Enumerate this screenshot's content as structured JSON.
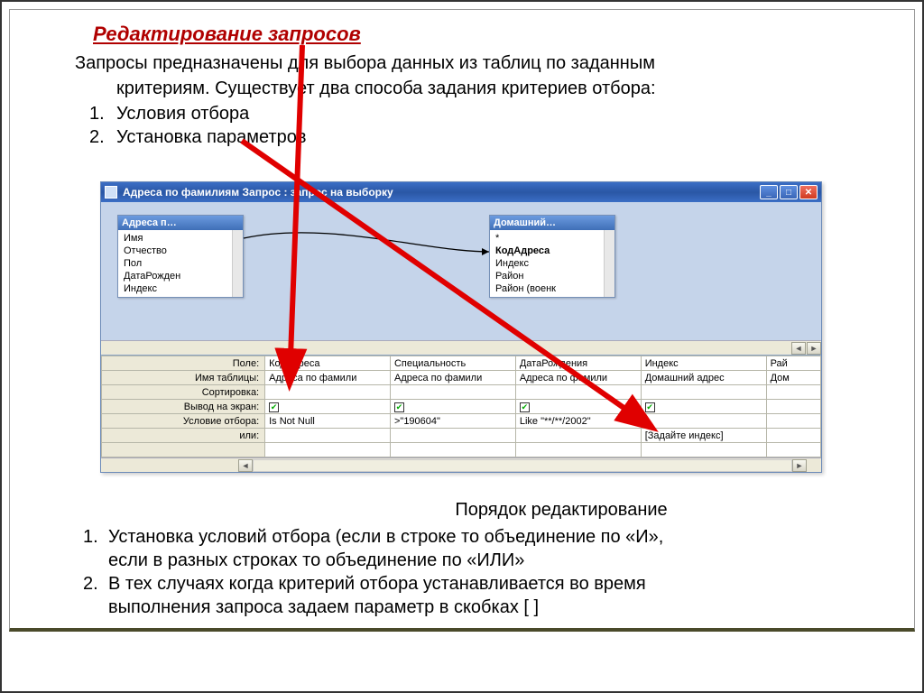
{
  "heading": "Редактирование запросов",
  "intro": {
    "p1": "Запросы предназначены для выбора данных из таблиц по заданным",
    "p2": "критериям. Существует два способа задания критериев отбора:",
    "item1_num": "1.",
    "item1": "Условия отбора",
    "item2_num": "2.",
    "item2": "Установка параметров"
  },
  "window": {
    "title": "Адреса по фамилиям Запрос : запрос на выборку",
    "boxes": {
      "left": {
        "title": "Адреса п…",
        "items": [
          "Имя",
          "Отчество",
          "Пол",
          "ДатаРожден",
          "Индекс"
        ]
      },
      "right": {
        "title": "Домашний…",
        "items": [
          "*",
          "КодАдреса",
          "Индекс",
          "Район",
          "Район (военк"
        ]
      }
    },
    "grid": {
      "rows": [
        "Поле:",
        "Имя таблицы:",
        "Сортировка:",
        "Вывод на экран:",
        "Условие отбора:",
        "или:"
      ],
      "columns": [
        {
          "field": "КодАдреса",
          "table": "Адреса по фамили",
          "check": true,
          "criteria": "Is Not Null",
          "or": ""
        },
        {
          "field": "Специальность",
          "table": "Адреса по фамили",
          "check": true,
          "criteria": ">\"190604\"",
          "or": ""
        },
        {
          "field": "ДатаРождения",
          "table": "Адреса по фамили",
          "check": true,
          "criteria": "Like \"**/**/2002\"",
          "or": ""
        },
        {
          "field": "Индекс",
          "table": "Домашний адрес",
          "check": true,
          "criteria": "",
          "or": "[Задайте индекс]"
        },
        {
          "field": "Рай",
          "table": "Дом",
          "check": false,
          "criteria": "",
          "or": ""
        }
      ]
    }
  },
  "footer": {
    "subtitle": "Порядок редактирование",
    "item1_num": "1.",
    "item1a": " Установка условий отбора (если в строке то объединение по «И»,",
    "item1b": "если в разных строках то объединение по «ИЛИ»",
    "item2_num": "2.",
    "item2a": "В тех случаях когда критерий отбора устанавливается во время",
    "item2b": "выполнения запроса задаем параметр в скобках [ ]"
  }
}
